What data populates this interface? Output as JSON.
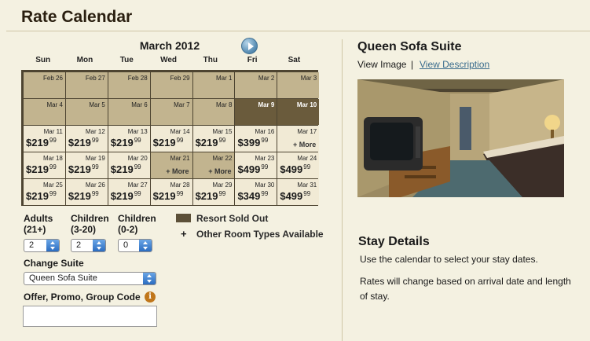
{
  "title": "Rate Calendar",
  "calendar": {
    "month": "March 2012",
    "days_of_week": [
      "Sun",
      "Mon",
      "Tue",
      "Wed",
      "Thu",
      "Fri",
      "Sat"
    ],
    "weeks": [
      [
        {
          "date": "Feb 26",
          "status": "unavailable"
        },
        {
          "date": "Feb 27",
          "status": "unavailable"
        },
        {
          "date": "Feb 28",
          "status": "unavailable"
        },
        {
          "date": "Feb 29",
          "status": "unavailable"
        },
        {
          "date": "Mar 1",
          "status": "unavailable"
        },
        {
          "date": "Mar 2",
          "status": "unavailable"
        },
        {
          "date": "Mar 3",
          "status": "unavailable"
        }
      ],
      [
        {
          "date": "Mar 4",
          "status": "unavailable"
        },
        {
          "date": "Mar 5",
          "status": "unavailable"
        },
        {
          "date": "Mar 6",
          "status": "unavailable"
        },
        {
          "date": "Mar 7",
          "status": "unavailable"
        },
        {
          "date": "Mar 8",
          "status": "unavailable"
        },
        {
          "date": "Mar 9",
          "status": "sold_out"
        },
        {
          "date": "Mar 10",
          "status": "sold_out"
        }
      ],
      [
        {
          "date": "Mar 11",
          "status": "priced",
          "dollars": "$219",
          "cents": "99"
        },
        {
          "date": "Mar 12",
          "status": "priced",
          "dollars": "$219",
          "cents": "99"
        },
        {
          "date": "Mar 13",
          "status": "priced",
          "dollars": "$219",
          "cents": "99"
        },
        {
          "date": "Mar 14",
          "status": "priced",
          "dollars": "$219",
          "cents": "99"
        },
        {
          "date": "Mar 15",
          "status": "priced",
          "dollars": "$219",
          "cents": "99"
        },
        {
          "date": "Mar 16",
          "status": "priced",
          "dollars": "$399",
          "cents": "99"
        },
        {
          "date": "Mar 17",
          "status": "more",
          "more": "+ More"
        }
      ],
      [
        {
          "date": "Mar 18",
          "status": "priced",
          "dollars": "$219",
          "cents": "99"
        },
        {
          "date": "Mar 19",
          "status": "priced",
          "dollars": "$219",
          "cents": "99"
        },
        {
          "date": "Mar 20",
          "status": "priced",
          "dollars": "$219",
          "cents": "99"
        },
        {
          "date": "Mar 21",
          "status": "unavail_more",
          "more": "+ More"
        },
        {
          "date": "Mar 22",
          "status": "unavail_more",
          "more": "+ More"
        },
        {
          "date": "Mar 23",
          "status": "priced",
          "dollars": "$499",
          "cents": "99"
        },
        {
          "date": "Mar 24",
          "status": "priced",
          "dollars": "$499",
          "cents": "99"
        }
      ],
      [
        {
          "date": "Mar 25",
          "status": "priced",
          "dollars": "$219",
          "cents": "99"
        },
        {
          "date": "Mar 26",
          "status": "priced",
          "dollars": "$219",
          "cents": "99"
        },
        {
          "date": "Mar 27",
          "status": "priced",
          "dollars": "$219",
          "cents": "99"
        },
        {
          "date": "Mar 28",
          "status": "priced",
          "dollars": "$219",
          "cents": "99"
        },
        {
          "date": "Mar 29",
          "status": "priced",
          "dollars": "$219",
          "cents": "99"
        },
        {
          "date": "Mar 30",
          "status": "priced",
          "dollars": "$349",
          "cents": "99"
        },
        {
          "date": "Mar 31",
          "status": "priced",
          "dollars": "$499",
          "cents": "99"
        }
      ]
    ]
  },
  "guests": {
    "adults_label": "Adults",
    "adults_sub": "(21+)",
    "adults_value": "2",
    "children_label": "Children",
    "children_sub": "(3-20)",
    "children_value": "2",
    "infants_label": "Children",
    "infants_sub": "(0-2)",
    "infants_value": "0"
  },
  "legend": {
    "sold_out": "Resort Sold Out",
    "plus_symbol": "+",
    "other_types": "Other Room Types Available"
  },
  "suite_select": {
    "label": "Change Suite",
    "value": "Queen Sofa Suite"
  },
  "promo": {
    "label": "Offer, Promo, Group Code",
    "info_icon": "i",
    "value": ""
  },
  "suite_info": {
    "title": "Queen Sofa Suite",
    "view_image": "View Image",
    "separator": "|",
    "view_description": "View Description"
  },
  "stay_details": {
    "title": "Stay Details",
    "line1": "Use the calendar to select your stay dates.",
    "line2": "Rates will change based on arrival date and length of stay."
  },
  "colors": {
    "background": "#f4f1e1",
    "calendar_border": "#4d4431",
    "unavailable": "#c2b48f",
    "available": "#f1ead5",
    "sold_out": "#6a5b3c",
    "link": "#3a6c8d"
  }
}
